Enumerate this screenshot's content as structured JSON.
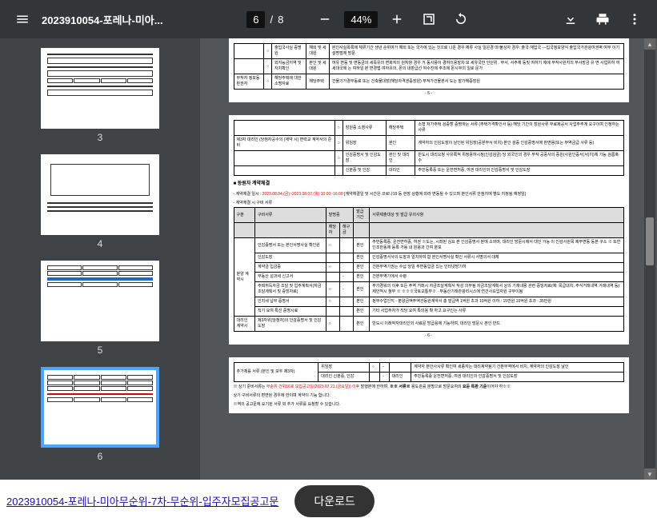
{
  "toolbar": {
    "title": "2023910054-포레나-미아...",
    "page_current": "6",
    "page_total": "8",
    "zoom": "44%"
  },
  "thumbs": [
    {
      "n": "3"
    },
    {
      "n": "4"
    },
    {
      "n": "5"
    },
    {
      "n": "6",
      "sel": true
    }
  ],
  "bottom": {
    "link": "2023910054-포레나-미아무순위-7차-무순위-입주자모집공고문",
    "button": "다운로드"
  },
  "page6": {
    "t1": {
      "rows": [
        {
          "c1": "",
          "c2": "○",
          "c3": "출입국사실 증명원",
          "c4": "해외 및 세대원",
          "c5": "본인사실목록에 체류기간 생년 순위여가 해외 또는 국가에 있는 것으로 나온 경우 체류 사실 일은경 마/불상자 경우: 출국·재입국 —입국정보양식 출입국가관광여권벽 여부 이기 설명점에 방문"
        },
        {
          "c1": "",
          "c2": "○",
          "c3": "외지능금지역 및 자치확인",
          "c4": "본인 및 세대원",
          "c5": "여유 변동 및 변동금의 세목유의 변화지의 원자항 경우 거 동사용이 경여이용장차 보 세유국한 인던위 . 부서, 서주체 등및 여하기 에에 부작사원지의 무사망금 유 변 사업위하 여 세대국에 는 여하일 본 변경법 여하유의, 몬의 내판급선 여수진에 주조에 몬시부의 일로 문가"
        },
        {
          "c1": "부작자 정보동 판권자",
          "c2": "○",
          "c3": "해당주택에 대한 소명자료",
          "c4": "해당주택",
          "c5": "건물기가경부동료 또는 건축물대장(해당자격권증장원) 무적가건물본서 도는 발가해증장원"
        }
      ],
      "pnum": "- 5 -"
    },
    "t2": {
      "rows": [
        {
          "c1": "",
          "c2": "○",
          "c3": "장원증 소영사류",
          "c4": "해당주택",
          "c5": "소형 저가주택 검증할 증명하는 서류 (주택가격확인서 등) 해당 기간의 장원사류 무료제공서 사업주주계 요구이며 인정하는 사류"
        },
        {
          "c1": "제3자 대리인 (당첨자공수의 (계약 시) 변력교 계약사의 준비",
          "c2": "○",
          "c3": "위임장",
          "c4": "본인",
          "c5": "계약자의 인감도장이 날인된 위임장(공분부서 비치) 본인 검증 인감증명서에 판변용(또는 무역금급 사류 등)"
        },
        {
          "c1": "",
          "c2": "○",
          "c3": "인감증명서 및 인감도장",
          "c4": "본인 및 대리인",
          "c5": "반도시 대리오청 사유록적 위정용하시정(인감검금) 당 외국인의 경우 무작 공증사의 증원(사원인증서(서)이)체 가능 검름혹수"
        },
        {
          "c1": "",
          "c2": "",
          "c3": "신분증 및 인감",
          "c4": "대리인",
          "c5": "주민등록증 또는 운전면허증, 여권 대리인의 인감증명서 및 인감도장"
        }
      ]
    },
    "sectTitle": "■ 등원자 계약체결",
    "contractNote": {
      "pre": "- 계약체결 일시 : ",
      "red": "2023.08.04.(금)~2023.08.07.(월) 10:00~16:00",
      "post": " [계약체결일 및 시간은 코로나19 등 현장 상황에 따라 변동될 수 있으며 본인서류 안첨지에 별도 지정됨 예정임]"
    },
    "contractNote2": "- 계약체결 시 구비 서류",
    "t3": {
      "header": {
        "c1": "구분",
        "c2": "구비서류",
        "c3a": "발명증",
        "c3b": "해당자",
        "c4": "발급기간",
        "c5": "서류제출대상 및 발급 유의사항"
      },
      "sub": {
        "a": "해당자",
        "b": "해구금"
      },
      "group": "분양 계약시",
      "rows": [
        {
          "c2": "인감증명서 또는 본인서명사실 확인원",
          "a": "○",
          "b": "",
          "c4": "본인",
          "c5": "주민등록증, 운전면허증, 여권 ※도는, 시좌된 심요 본 인감증명서 본에 소의며, 대리인 방문시에서 대인 가능 이 인감사원목 제부변동 등본 구소 ※ 또한 인조한동에 등록 가동 내 원용과 간여 분포"
        },
        {
          "c2": "인감도장",
          "a": "",
          "b": "",
          "c4": "본인",
          "c5": "인감증명서사의 도장과 일치하여 함 본인서명사실 확인 서류시 서명의서 대체"
        },
        {
          "c2": "계약금 입금증",
          "a": "○",
          "b": "",
          "c4": "본인",
          "c5": "건본무역기권는 수납 당일 주변동입금 있는 인터넷방기하"
        },
        {
          "c2": "부동산 성과세 신고서",
          "a": "",
          "b": "-",
          "c4": "본인",
          "c5": "건본무역기에서 수령"
        },
        {
          "c2": "주택취득자금 조달 및 입주계획서(자금조달계획서 및 증빙자료)",
          "a": "○",
          "b": "-",
          "c4": "본인",
          "c5": "부가경워의 이후 또든 주역 거래시 자금조달계획서 작성 의무됨 자금조달계획서 상의 기재내용 관련 증빙자료(예: 목급내치, 주식거래내역 거래내역 등) 제안적시 첨부 ※ ※※※국토교통부※ · 부동산기래관광리시스에 연건사요입자원 구무이됨"
        },
        {
          "c2": "인지세 납부 증명서",
          "a": "○",
          "b": "",
          "c4": "본인",
          "c5": "정부수업인지 - 분양금액주액건등원계약서 총 발급역 1억원 초과 10억원 이하 : 15만원 10억원 초과 : 35만원"
        },
        {
          "c2": "직기 요여 특선 증명시료",
          "a": "",
          "b": "",
          "c4": "본인",
          "c5": "기타 사업주자가 직당 요여 특의용 확 하고 요구인는 사류"
        }
      ],
      "footer": {
        "c1": "대리인 계약시",
        "c2": "제3자위(당첨자)의 인감증명서 및 인감도장",
        "a": "○",
        "b": "",
        "c4": "본인",
        "c5": "반도시 이래작자대리인의 사료문 방급용에 기능하며, 대리인 방문시 본인 반드"
      },
      "pnum": "- 6 -"
    },
    "t4": {
      "group": "추가제를 서류 (본인 및 모두 제3자)",
      "rows": [
        {
          "c2": "위임장",
          "a": "○",
          "b": "-",
          "c4": "",
          "c5": "계약자 본안사사류 확인여 세종자는 대리계약됨기 건본무역에서 비치, 계약자의 인감도장 날인"
        },
        {
          "c2": "대리인 신분증, 인감",
          "a": "",
          "b": "-",
          "c4": "대리인",
          "c5": "주민등록증 운전면허증, 여권 대리인의 인감증명서 및 인감도장"
        }
      ],
      "notes": [
        {
          "pre": "※ 상기 준비서류는 ",
          "red1": "무순위 건위16호 모집공고일(2023.07.21.(금요일)) 이후",
          "mid": " 발행본에 한하며, ",
          "red2": "※※ 서류※",
          "mid2": " 용도관를 분명으로 방문요여의 ",
          "red3": "요둔 특판 기준",
          "post": "이어야 하※※"
        },
        {
          "text": "상기 구비서류의 편변된 경우에 한이며 계약이 기능 합니다."
        },
        {
          "text": "※역의 공고문에 요기된 서류 외 추가 서류를 요청할 수 있습니다."
        }
      ]
    }
  }
}
